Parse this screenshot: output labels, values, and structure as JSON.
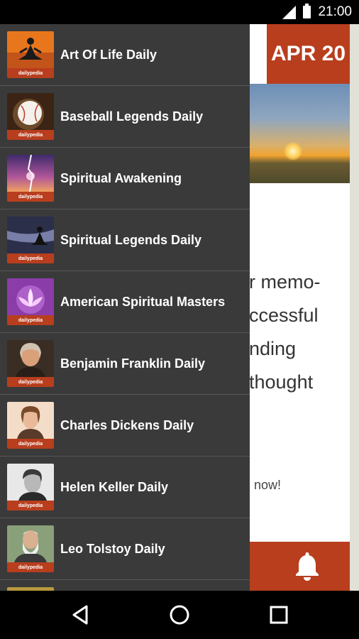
{
  "status_bar": {
    "time": "21:00"
  },
  "background": {
    "date": "APR 20",
    "text_lines": [
      "r memo-",
      "ccessful",
      "nding",
      "thought"
    ],
    "small_text": "now!"
  },
  "drawer": {
    "tag_label": "dailypedia",
    "items": [
      {
        "label": "Art Of Life Daily"
      },
      {
        "label": "Baseball Legends Daily"
      },
      {
        "label": "Spiritual Awakening"
      },
      {
        "label": "Spiritual Legends Daily"
      },
      {
        "label": "American Spiritual Masters"
      },
      {
        "label": "Benjamin Franklin Daily"
      },
      {
        "label": "Charles Dickens Daily"
      },
      {
        "label": "Helen Keller Daily"
      },
      {
        "label": "Leo Tolstoy Daily"
      }
    ]
  },
  "colors": {
    "accent": "#b83e1e",
    "drawer_bg": "#3a3a3a"
  },
  "icons": [
    "signal-icon",
    "battery-icon",
    "bell-icon",
    "back-icon",
    "home-icon",
    "recents-icon"
  ]
}
